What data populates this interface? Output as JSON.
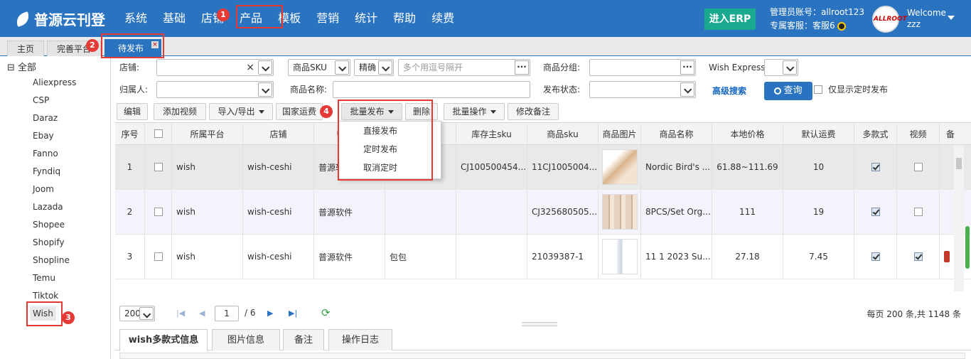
{
  "header": {
    "logo_text": "普源云刊登",
    "nav": [
      "系统",
      "基础",
      "店铺",
      "产品",
      "模板",
      "营销",
      "统计",
      "帮助",
      "续费"
    ],
    "erp_button": "进入ERP",
    "admin_account": "管理员账号：allroot123",
    "service": "专属客服：客服6",
    "avatar_text": "ALLROOT",
    "welcome": "Welcome",
    "username": "zzz"
  },
  "tabs": [
    {
      "label": "主页"
    },
    {
      "label": "完善平台"
    },
    {
      "label": "待发布",
      "close": "×"
    }
  ],
  "badges": {
    "b1": "1",
    "b2": "2",
    "b3": "3",
    "b4": "4"
  },
  "tree": {
    "root": "⊟ 全部",
    "items": [
      "Aliexpress",
      "CSP",
      "Daraz",
      "Ebay",
      "Fanno",
      "Fyndiq",
      "Joom",
      "Lazada",
      "Shopee",
      "Shopify",
      "Shopline",
      "Temu",
      "Tiktok",
      "Wish"
    ]
  },
  "filters": {
    "shop_label": "店铺:",
    "shop_clear": "×",
    "sku_type": "商品SKU",
    "match": "精确",
    "sku_placeholder": "多个用逗号隔开",
    "more": "···",
    "group_label": "商品分组:",
    "wish_express_label": "Wish Express:",
    "owner_label": "归属人:",
    "name_label": "商品名称:",
    "status_label": "发布状态:",
    "advanced": "高级搜索",
    "search": "查询",
    "only_scheduled": "仅显示定时发布"
  },
  "toolbar": [
    "编辑",
    "添加视频",
    "导入/导出",
    "国家运费",
    "批量发布",
    "删除",
    "批量操作",
    "修改备注"
  ],
  "dropdown_menu": [
    "直接发布",
    "定时发布",
    "取消定时"
  ],
  "grid": {
    "columns": [
      "序号",
      "",
      "所属平台",
      "店铺",
      "归属人",
      "",
      "库存主sku",
      "商品sku",
      "商品图片",
      "商品名称",
      "本地价格",
      "默认运费",
      "多款式",
      "视频",
      "备"
    ],
    "rows": [
      {
        "no": "1",
        "platform": "wish",
        "shop": "wish-ceshi",
        "owner": "普源软件",
        "note": "",
        "main_sku": "CJ100500454...",
        "sku": "11CJ1005004...",
        "name": "Nordic Bird's ...",
        "price": "61.88~111.69",
        "shipping": "10",
        "multi": true,
        "video": false
      },
      {
        "no": "2",
        "platform": "wish",
        "shop": "wish-ceshi",
        "owner": "普源软件",
        "note": "",
        "main_sku": "",
        "sku": "CJ325680505...",
        "name": "8PCS/Set Org...",
        "price": "111",
        "shipping": "19",
        "multi": true,
        "video": false
      },
      {
        "no": "3",
        "platform": "wish",
        "shop": "wish-ceshi",
        "owner": "普源软件",
        "note": "包包",
        "main_sku": "",
        "sku": "21039387-1",
        "name": "11 1 2023 Su...",
        "price": "27.18",
        "shipping": "7.45",
        "multi": true,
        "video": true
      }
    ]
  },
  "pager": {
    "page_size": "200",
    "page": "1",
    "total_pages": "/ 6",
    "summary": "每页 200 条,共 1148 条"
  },
  "bottom_tabs": [
    "wish多款式信息",
    "图片信息",
    "备注",
    "操作日志"
  ],
  "colors": {
    "primary": "#2a73c0",
    "erp": "#1aa98e",
    "highlight": "#e53935"
  }
}
